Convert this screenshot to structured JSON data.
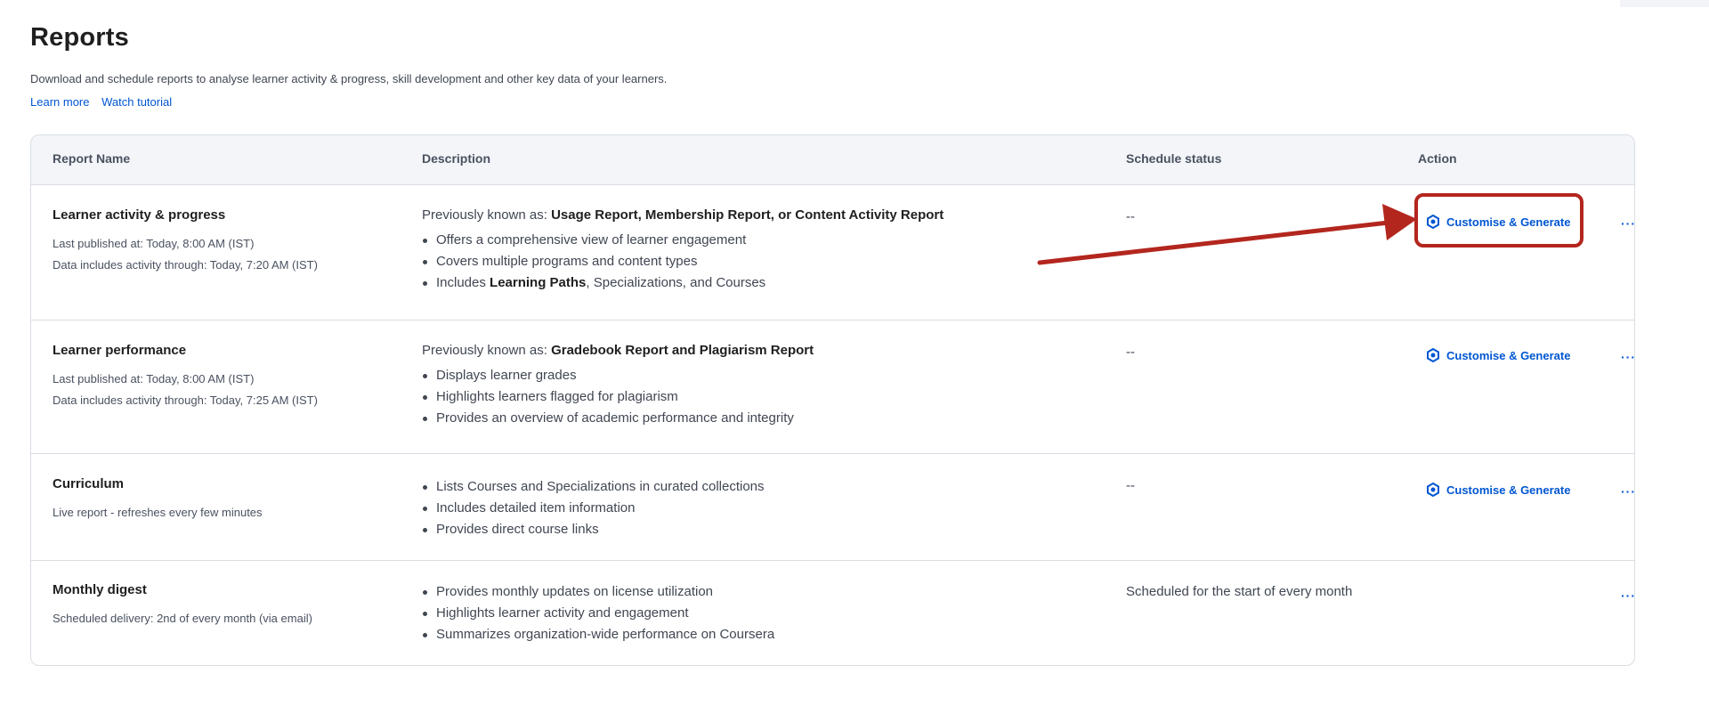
{
  "page": {
    "title": "Reports",
    "subtitle": "Download and schedule reports to analyse learner activity & progress, skill development and other key data of your learners.",
    "links": [
      "Learn more",
      "Watch tutorial"
    ]
  },
  "table": {
    "headers": {
      "name": "Report Name",
      "description": "Description",
      "status": "Schedule status",
      "action": "Action"
    },
    "rows": [
      {
        "name": "Learner activity & progress",
        "meta": [
          "Last published at: Today, 8:00 AM (IST)",
          "Data includes activity through: Today, 7:20 AM (IST)"
        ],
        "prev_label": "Previously known as:",
        "prev_value": "Usage Report, Membership Report, or Content Activity Report",
        "bullets": [
          "Offers a comprehensive view of learner engagement",
          "Covers multiple programs and content types"
        ],
        "bullet_bold": "Learning Paths",
        "bullet_pre": "Includes",
        "bullet_post": ", Specializations, and Courses",
        "status": "--",
        "action_label": "Customise & Generate",
        "more_label": "···"
      },
      {
        "name": "Learner performance",
        "meta": [
          "Last published at: Today, 8:00 AM (IST)",
          "Data includes activity through: Today, 7:25 AM (IST)"
        ],
        "prev_label": "Previously known as:",
        "prev_value": "Gradebook Report and Plagiarism Report",
        "bullets": [
          "Displays learner grades",
          "Highlights learners flagged for plagiarism",
          "Provides an overview of academic performance and integrity"
        ],
        "status": "--",
        "action_label": "Customise & Generate",
        "more_label": "···"
      },
      {
        "name": "Curriculum",
        "meta": [
          "Live report - refreshes every few minutes"
        ],
        "bullets": [
          "Lists Courses and Specializations in curated collections",
          "Includes detailed item information",
          "Provides direct course links"
        ],
        "status": "--",
        "action_label": "Customise & Generate",
        "more_label": "···"
      },
      {
        "name": "Monthly digest",
        "meta": [
          "Scheduled delivery: 2nd of every month (via email)"
        ],
        "bullets": [
          "Provides monthly updates on license utilization",
          "Highlights learner activity and engagement",
          "Summarizes organization-wide performance on Coursera"
        ],
        "status": "Scheduled for the start of every month",
        "more_label": "···"
      }
    ]
  },
  "annotation": {
    "color": "#b3261e"
  },
  "colors": {
    "link": "#0056d2",
    "header_bg": "#f3f5f9",
    "border": "#d9dde3"
  },
  "icons": {
    "generate": "gear-hexagon-icon",
    "more": "ellipsis-icon"
  }
}
